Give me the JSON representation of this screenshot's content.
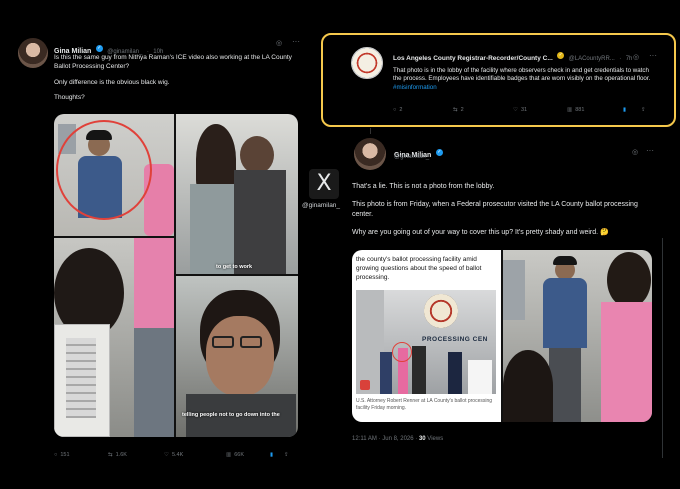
{
  "tweet_left": {
    "name": "Gina Milian",
    "handle": "@ginamilan_",
    "time": "10h",
    "text_1": "Is this the same guy from Nithya Raman's ICE video also working at the LA County Ballot Processing Center?",
    "text_2": "Only difference is the obvious black wig.",
    "text_3": "Thoughts?",
    "caption_1": "to get to work",
    "caption_2": "telling people not to go down into the",
    "replies": "151",
    "retweets": "1.6K",
    "likes": "5.4K",
    "views": "66K"
  },
  "tweet_county": {
    "name": "Los Angeles County Registrar-Recorder/County C...",
    "handle": "@LACountyRR...",
    "time": "7h",
    "text": "That photo is in the lobby of the facility where observers check in and get credentials to watch the process. Employees have identifiable badges that are worn visibly on the operational floor.",
    "hashtag": "#misinformation",
    "replies": "2",
    "retweets": "2",
    "likes": "31",
    "views": "881"
  },
  "x_logo": {
    "symbol": "X",
    "handle": "@ginamilan_"
  },
  "tweet_reply": {
    "name": "Gina Milian",
    "handle": "@ginamilan_",
    "text_1": "That's a lie. This is not a photo from the lobby.",
    "text_2": "This photo is from Friday, when a Federal prosecutor visited the LA County ballot processing center.",
    "text_3": "Why are you going out of your way to cover this up? It's pretty shady and weird. 🤔",
    "article_headline": "the county's ballot processing facility amid growing questions about the speed of ballot processing.",
    "article_caption": "U.S. Attorney Robert Renner at LA County's ballot processing facility Friday morning.",
    "sign_text": "PROCESSING CEN",
    "timestamp": "12:11 AM · Jun 8, 2026 ·",
    "views_count": "30",
    "views_label": "Views"
  },
  "colors": {
    "background": "#000000",
    "highlight": "#f5c84c",
    "link": "#1d9bf0",
    "muted": "#71767b",
    "text": "#e7e9ea"
  }
}
